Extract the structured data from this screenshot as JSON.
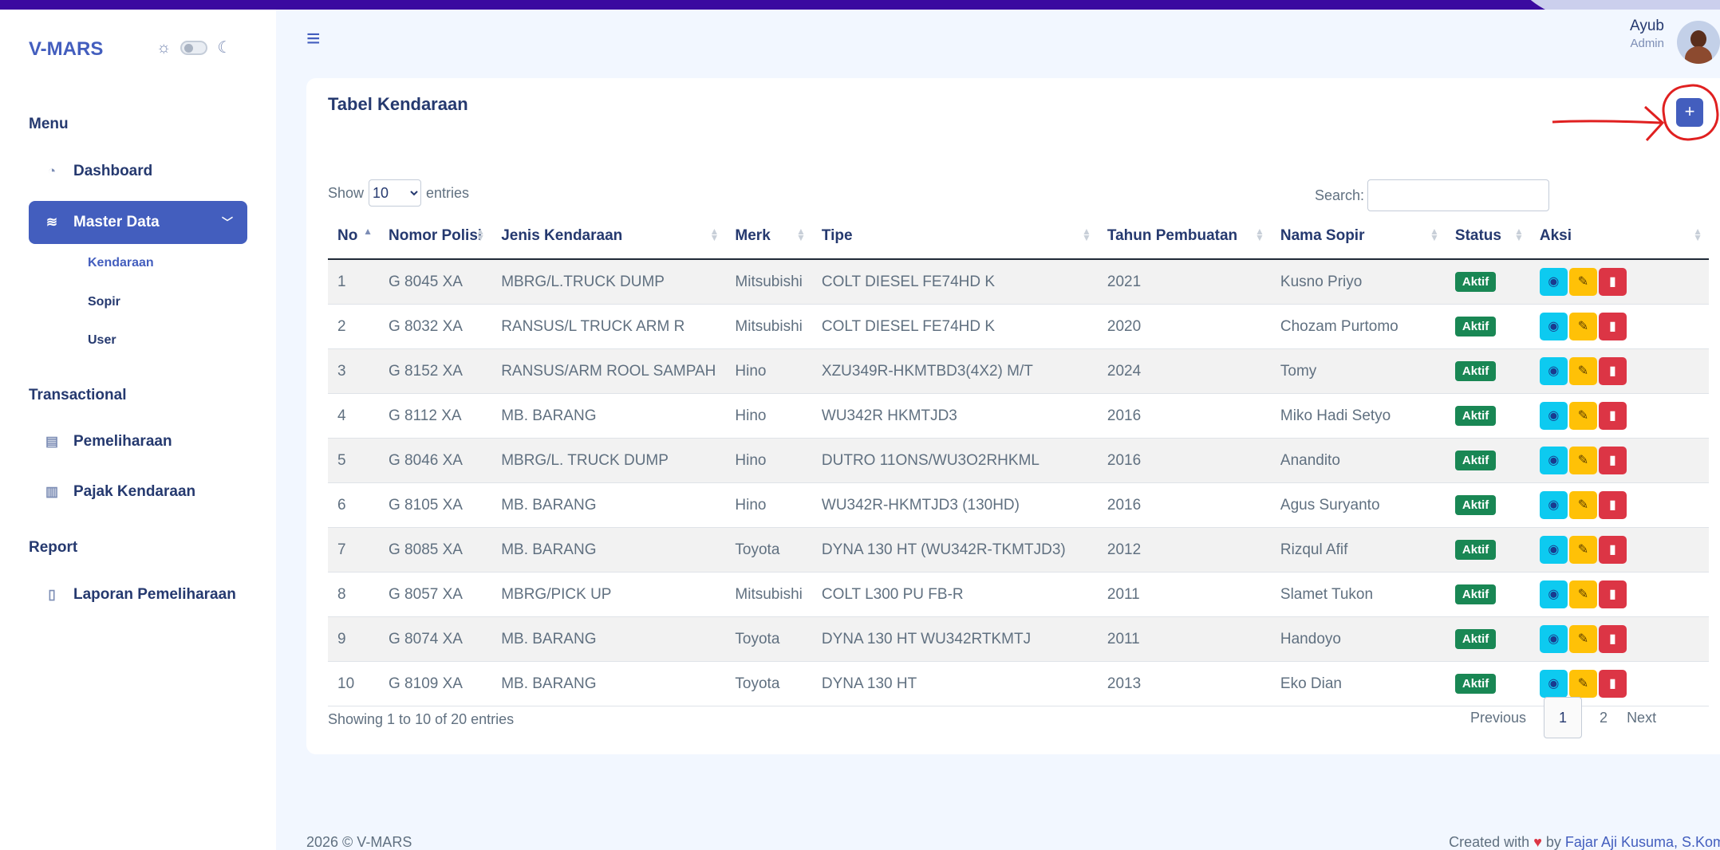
{
  "brand": "V-MARS",
  "theme": {
    "sun_icon": "☼",
    "moon_icon": "☾"
  },
  "sidebar": {
    "menu_title": "Menu",
    "dashboard": "Dashboard",
    "master_data": "Master Data",
    "master_children": [
      "Kendaraan",
      "Sopir",
      "User"
    ],
    "transactional_title": "Transactional",
    "pemeliharaan": "Pemeliharaan",
    "pajak_kendaraan": "Pajak Kendaraan",
    "report_title": "Report",
    "laporan_pemeliharaan": "Laporan Pemeliharaan"
  },
  "header": {
    "hamburger": "≡",
    "user_name": "Ayub",
    "user_role": "Admin"
  },
  "card": {
    "title": "Tabel Kendaraan",
    "add_label": "+",
    "show_label": "Show",
    "entries_label": "entries",
    "length_value": "10",
    "search_label": "Search:",
    "search_value": ""
  },
  "table": {
    "columns": [
      "No",
      "Nomor Polisi",
      "Jenis Kendaraan",
      "Merk",
      "Tipe",
      "Tahun Pembuatan",
      "Nama Sopir",
      "Status",
      "Aksi"
    ],
    "rows": [
      [
        "1",
        "G 8045 XA",
        "MBRG/L.TRUCK DUMP",
        "Mitsubishi",
        "COLT DIESEL FE74HD K",
        "2021",
        "Kusno Priyo",
        "Aktif"
      ],
      [
        "2",
        "G 8032 XA",
        "RANSUS/L TRUCK ARM R",
        "Mitsubishi",
        "COLT DIESEL FE74HD K",
        "2020",
        "Chozam Purtomo",
        "Aktif"
      ],
      [
        "3",
        "G 8152 XA",
        "RANSUS/ARM ROOL SAMPAH",
        "Hino",
        "XZU349R-HKMTBD3(4X2) M/T",
        "2024",
        "Tomy",
        "Aktif"
      ],
      [
        "4",
        "G 8112 XA",
        "MB. BARANG",
        "Hino",
        "WU342R HKMTJD3",
        "2016",
        "Miko Hadi Setyo",
        "Aktif"
      ],
      [
        "5",
        "G 8046 XA",
        "MBRG/L. TRUCK DUMP",
        "Hino",
        "DUTRO 11ONS/WU3O2RHKML",
        "2016",
        "Anandito",
        "Aktif"
      ],
      [
        "6",
        "G 8105 XA",
        "MB. BARANG",
        "Hino",
        "WU342R-HKMTJD3 (130HD)",
        "2016",
        "Agus Suryanto",
        "Aktif"
      ],
      [
        "7",
        "G 8085 XA",
        "MB. BARANG",
        "Toyota",
        "DYNA 130 HT (WU342R-TKMTJD3)",
        "2012",
        "Rizqul Afif",
        "Aktif"
      ],
      [
        "8",
        "G 8057 XA",
        "MBRG/PICK UP",
        "Mitsubishi",
        "COLT L300 PU FB-R",
        "2011",
        "Slamet Tukon",
        "Aktif"
      ],
      [
        "9",
        "G 8074 XA",
        "MB. BARANG",
        "Toyota",
        "DYNA 130 HT WU342RTKMTJ",
        "2011",
        "Handoyo",
        "Aktif"
      ],
      [
        "10",
        "G 8109 XA",
        "MB. BARANG",
        "Toyota",
        "DYNA 130 HT",
        "2013",
        "Eko Dian",
        "Aktif"
      ]
    ],
    "status_color": "#198754"
  },
  "pagination": {
    "info": "Showing 1 to 10 of 20 entries",
    "previous": "Previous",
    "pages": [
      "1",
      "2"
    ],
    "current": "1",
    "next": "Next"
  },
  "footer": {
    "left": "2026 © V-MARS",
    "created_with": "Created with",
    "by": "by",
    "author": "Fajar Aji Kusuma, S.Kom"
  },
  "colors": {
    "primary": "#435ebe",
    "info": "#0dcaf0",
    "warning": "#ffc107",
    "danger": "#dc3545",
    "success": "#198754"
  },
  "icons": {
    "dashboard": "gauge-icon",
    "master_data": "stack-icon",
    "pemeliharaan": "file-icon",
    "pajak": "receipt-icon",
    "laporan": "clipboard-icon",
    "view": "eye-icon",
    "edit": "pencil-icon",
    "delete": "trash-icon"
  }
}
